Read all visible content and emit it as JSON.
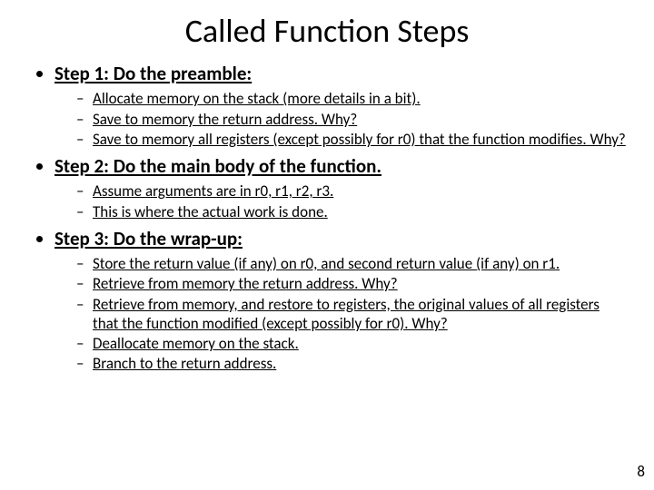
{
  "title": "Called Function Steps",
  "steps": [
    {
      "heading": "Step 1: Do the preamble:",
      "items": [
        "Allocate memory on the stack (more details in a bit).",
        "Save to memory the return address. Why?",
        "Save to memory all registers (except possibly for r0) that the function modifies. Why?"
      ]
    },
    {
      "heading": "Step 2: Do the main body of the function.",
      "items": [
        "Assume arguments are in r0, r1, r2, r3.",
        "This is where the actual work is done."
      ]
    },
    {
      "heading": "Step 3: Do the wrap-up:",
      "items": [
        "Store the return value (if any) on r0, and second return value (if any) on r1.",
        "Retrieve from memory the return address. Why?",
        "Retrieve from memory, and restore to registers, the original values of all registers that the function modified (except possibly for r0). Why?",
        "Deallocate memory on the stack.",
        "Branch to the return address."
      ]
    }
  ],
  "page_number": "8"
}
